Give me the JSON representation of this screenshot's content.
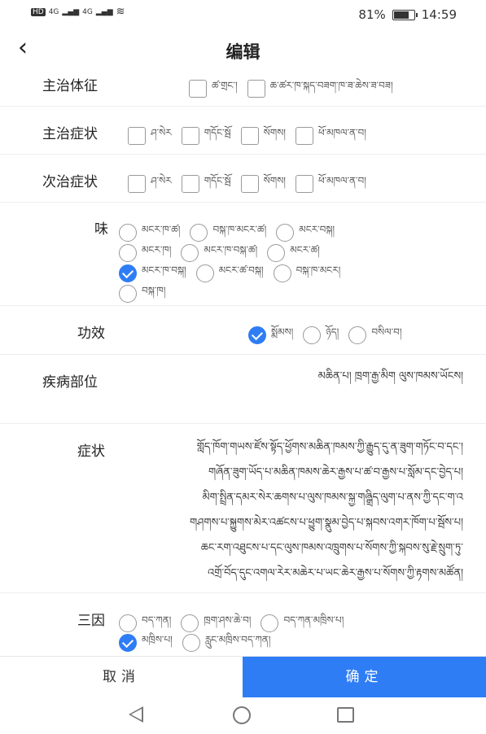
{
  "status": {
    "left_badges": [
      "HD",
      "HD",
      "4G",
      "4G"
    ],
    "battery": "81%",
    "battery_level": 0.81,
    "time": "14:59"
  },
  "header": {
    "back": "<",
    "title": "编辑"
  },
  "main_syndrome": {
    "label": "主治体征",
    "options": [
      "ཚ་གྲང་།",
      "ཆ་ཚར་ཁ་སྐད་བཟག་ཁ་ཟ་ཆེས་ཟ་བཟ།"
    ]
  },
  "main_symptoms": {
    "label": "主治症状",
    "options": [
      "ཤ་སེར",
      "གདོང་སྦོ",
      "སོགས།",
      "ཕོ་མཁལ་ན་བ།"
    ]
  },
  "secondary_symptoms": {
    "label": "次治症状",
    "options": [
      "ཤ་སེར",
      "གདོང་སྦོ",
      "སོགས།",
      "ཕོ་མཁལ་ན་བ།"
    ]
  },
  "taste": {
    "label": "味",
    "options": [
      "མངར་ཁ་ཚ།",
      "བསྐ་ཁ་མངར་ཚ།",
      "མངར་བསྐ།",
      "མངར་ཁ།",
      "མངར་ཁ་བསྐ་ཚ།",
      "མངར་ཚ།",
      "མངར་ཁ་བསྐ།",
      "མངར་ཚ་བསྐ།",
      "བསྐ་ཁ་མངར།",
      "བསྐ་ཁ།"
    ],
    "selected_index": 6
  },
  "efficacy": {
    "label": "功效",
    "options": [
      "སྨོམས།",
      "ཉོད།",
      "བསིལ་བ།"
    ],
    "selected_index": 0
  },
  "disease_site": {
    "label": "疾病部位",
    "value": "མཆིན་པ། ཁྲག་རྒྱ་མིག ལུས་ཁམས་ཡོངས།"
  },
  "symptoms": {
    "label": "症状",
    "lines": [
      "གློད་ཁོག་གཡས་ཛོས་སྟོད་ཕྱོགས་མཆིན་ཁམས་ཀྱི་རྒྱུད་དུ་ན་ཟུག་གཏོང་བ་དང་།",
      "གཞོན་ཟུག་ཡོད་པ་མཆིན་ཁམས་ཆེར་རྒྱས་པ་ཚ་བ་རྒྱས་པ་སློམ་དང་བྱེད་པ།",
      "མིག་སྤྲིན་དམར་སེར་ཆགས་པ་ལུས་ཁམས་སྐྱ་གཞྒྲིད་ལུག་པ་ནས་ཀྱི་དང་ག་འ",
      "གཤགས་པ་སྐྱུགས་མེར་འཚངས་པ་ཕྱུག་སྣུམ་བྱེད་པ་སྐབས་འགར་ཁོག་པ་སྦོས་པ།",
      "ཆང་རག་འཐུངས་པ་དང་ལུས་ཁམས་འཁྲུགས་པ་སོགས་ཀྱི་སྐབས་སུ་རྗེ་སྲུག་ཏུ་",
      "འགྲོ་བོད་དུང་འགལ་རེར་མཆེར་པ་ཡང་ཆེར་རྒྱས་པ་སོགས་ཀྱི་རྟགས་མཚོན།"
    ]
  },
  "three_causes": {
    "label": "三因",
    "options": [
      "བད་ཀན།",
      "ཁྲག་ཤས་ཆེ་བ།",
      "བད་ཀན་མཁྲིས་པ།",
      "མཁྲིས་པ།",
      "རླུང་མཁྲིས་བད་ཀན།"
    ],
    "selected_index": 3
  },
  "footer": {
    "cancel": "取消",
    "confirm": "确定"
  },
  "colors": {
    "accent": "#2e7df5",
    "text": "#222222",
    "divider": "#eeeeee"
  }
}
